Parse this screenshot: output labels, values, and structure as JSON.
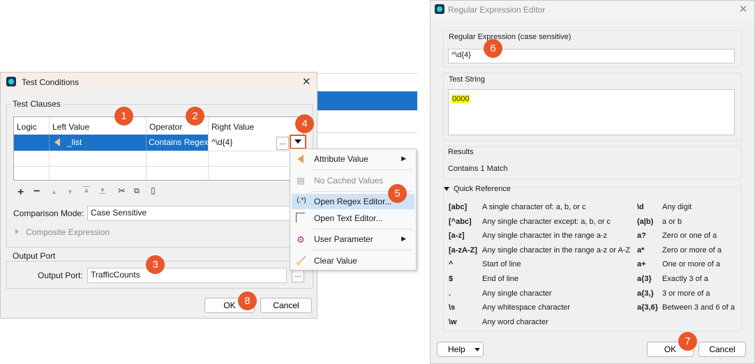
{
  "background": {},
  "test_conditions": {
    "title": "Test Conditions",
    "test_clauses_label": "Test Clauses",
    "columns": [
      "Logic",
      "Left Value",
      "Operator",
      "Right Value"
    ],
    "row": {
      "logic": "",
      "left_value": "_list",
      "operator": "Contains Regex",
      "right_value": "^\\d{4}"
    },
    "dots_label": "...",
    "comparison_mode_label": "Comparison Mode:",
    "comparison_mode_value": "Case Sensitive",
    "composite_expression_label": "Composite Expression",
    "output_port_group": "Output Port",
    "output_port_label": "Output Port:",
    "output_port_value": "TrafficCounts",
    "ok_label": "OK",
    "cancel_label": "Cancel",
    "toolbar_icons": [
      "plus-icon",
      "minus-icon",
      "move-up-icon",
      "move-down-icon",
      "move-top-icon",
      "move-bottom-icon",
      "cut-icon",
      "copy-icon",
      "paste-icon"
    ]
  },
  "context_menu": {
    "items": [
      {
        "label": "Attribute Value",
        "icon": "attribute-icon",
        "submenu": true,
        "disabled": false
      },
      {
        "label": "No Cached Values",
        "icon": "cache-icon",
        "submenu": false,
        "disabled": true
      },
      {
        "label": "Open Regex Editor...",
        "icon": "regex-icon",
        "submenu": false,
        "disabled": false,
        "highlighted": true
      },
      {
        "label": "Open Text Editor...",
        "icon": "text-editor-icon",
        "submenu": false,
        "disabled": false
      },
      {
        "label": "User Parameter",
        "icon": "parameter-icon",
        "submenu": true,
        "disabled": false
      },
      {
        "label": "Clear Value",
        "icon": "broom-icon",
        "submenu": false,
        "disabled": false
      }
    ],
    "regex_icon_glyph": "(.*)"
  },
  "regex_editor": {
    "title": "Regular Expression Editor",
    "regex_label": "Regular Expression (case sensitive)",
    "regex_value": "^\\d{4}",
    "test_string_label": "Test String",
    "test_string_value": "0000",
    "results_label": "Results",
    "results_value": "Contains 1 Match",
    "quick_reference_label": "Quick Reference",
    "quick_reference_left": [
      {
        "code": "[abc]",
        "desc": "A single character of: a, b, or c"
      },
      {
        "code": "[^abc]",
        "desc": "Any single character except: a, b, or c"
      },
      {
        "code": "[a-z]",
        "desc": "Any single character in the range a-z"
      },
      {
        "code": "[a-zA-Z]",
        "desc": "Any single character in the range a-z or A-Z"
      },
      {
        "code": "^",
        "desc": "Start of line"
      },
      {
        "code": "$",
        "desc": "End of line"
      },
      {
        "code": ".",
        "desc": "Any single character"
      },
      {
        "code": "\\s",
        "desc": "Any whitespace character"
      },
      {
        "code": "\\w",
        "desc": "Any word character"
      }
    ],
    "quick_reference_right": [
      {
        "code": "\\d",
        "desc": "Any digit"
      },
      {
        "code": "(a|b)",
        "desc": "a or b"
      },
      {
        "code": "a?",
        "desc": "Zero or one of a"
      },
      {
        "code": "a*",
        "desc": "Zero or more of a"
      },
      {
        "code": "a+",
        "desc": "One or more of a"
      },
      {
        "code": "a{3}",
        "desc": "Exactly 3 of a"
      },
      {
        "code": "a{3,}",
        "desc": "3 or more of a"
      },
      {
        "code": "a{3,6}",
        "desc": "Between 3 and 6 of a"
      }
    ],
    "help_label": "Help",
    "ok_label": "OK",
    "cancel_label": "Cancel"
  },
  "markers": [
    "1",
    "2",
    "3",
    "4",
    "5",
    "6",
    "7",
    "8"
  ],
  "colors": {
    "accent": "#e8562a",
    "selection": "#1a72c9",
    "highlight": "#ffff00",
    "menu_highlight": "#cfe3f7"
  }
}
